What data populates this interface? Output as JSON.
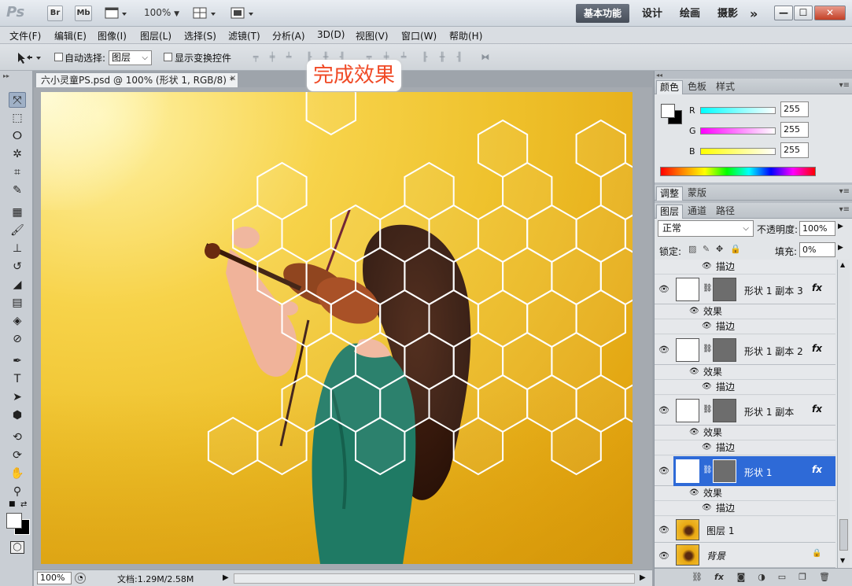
{
  "app": {
    "logo": "Ps",
    "bridge_label": "Br",
    "minibridge_label": "Mb",
    "zoom_level": "100%",
    "workspaces": [
      "基本功能",
      "设计",
      "绘画",
      "摄影"
    ],
    "more_workspaces": "»",
    "window_buttons": [
      "—",
      "☐",
      "✕"
    ]
  },
  "menu": [
    "文件(F)",
    "编辑(E)",
    "图像(I)",
    "图层(L)",
    "选择(S)",
    "滤镜(T)",
    "分析(A)",
    "3D(D)",
    "视图(V)",
    "窗口(W)",
    "帮助(H)"
  ],
  "options": {
    "auto_select_label": "自动选择:",
    "auto_select_value": "图层",
    "show_transform_label": "显示变换控件"
  },
  "document": {
    "tab_title": "六小灵童PS.psd @ 100% (形状 1, RGB/8) *",
    "close": "×",
    "annotation": "完成效果"
  },
  "status": {
    "zoom": "100%",
    "doc_info": "文档:1.29M/2.58M"
  },
  "panels": {
    "color_tabs": [
      "颜色",
      "色板",
      "样式"
    ],
    "rgb": [
      {
        "channel": "R",
        "value": "255"
      },
      {
        "channel": "G",
        "value": "255"
      },
      {
        "channel": "B",
        "value": "255"
      }
    ],
    "adjust_tabs": [
      "调整",
      "蒙版"
    ],
    "layer_tabs": [
      "图层",
      "通道",
      "路径"
    ],
    "blend_mode": "正常",
    "opacity_label": "不透明度:",
    "opacity_value": "100%",
    "lock_label": "锁定:",
    "fill_label": "填充:",
    "fill_value": "0%"
  },
  "layers": {
    "top_sub": "描边",
    "items": [
      {
        "name": "形状 1 副本 3",
        "fx": "fx",
        "effect": "效果",
        "stroke": "描边"
      },
      {
        "name": "形状 1 副本 2",
        "fx": "fx",
        "effect": "效果",
        "stroke": "描边"
      },
      {
        "name": "形状 1 副本",
        "fx": "fx",
        "effect": "效果",
        "stroke": "描边"
      },
      {
        "name": "形状 1",
        "fx": "fx",
        "effect": "效果",
        "stroke": "描边"
      }
    ],
    "layer1": "图层 1",
    "background": "背景"
  },
  "colors": {
    "accent_selected": "#2e6ad7",
    "annotation_red": "#f04a26"
  }
}
